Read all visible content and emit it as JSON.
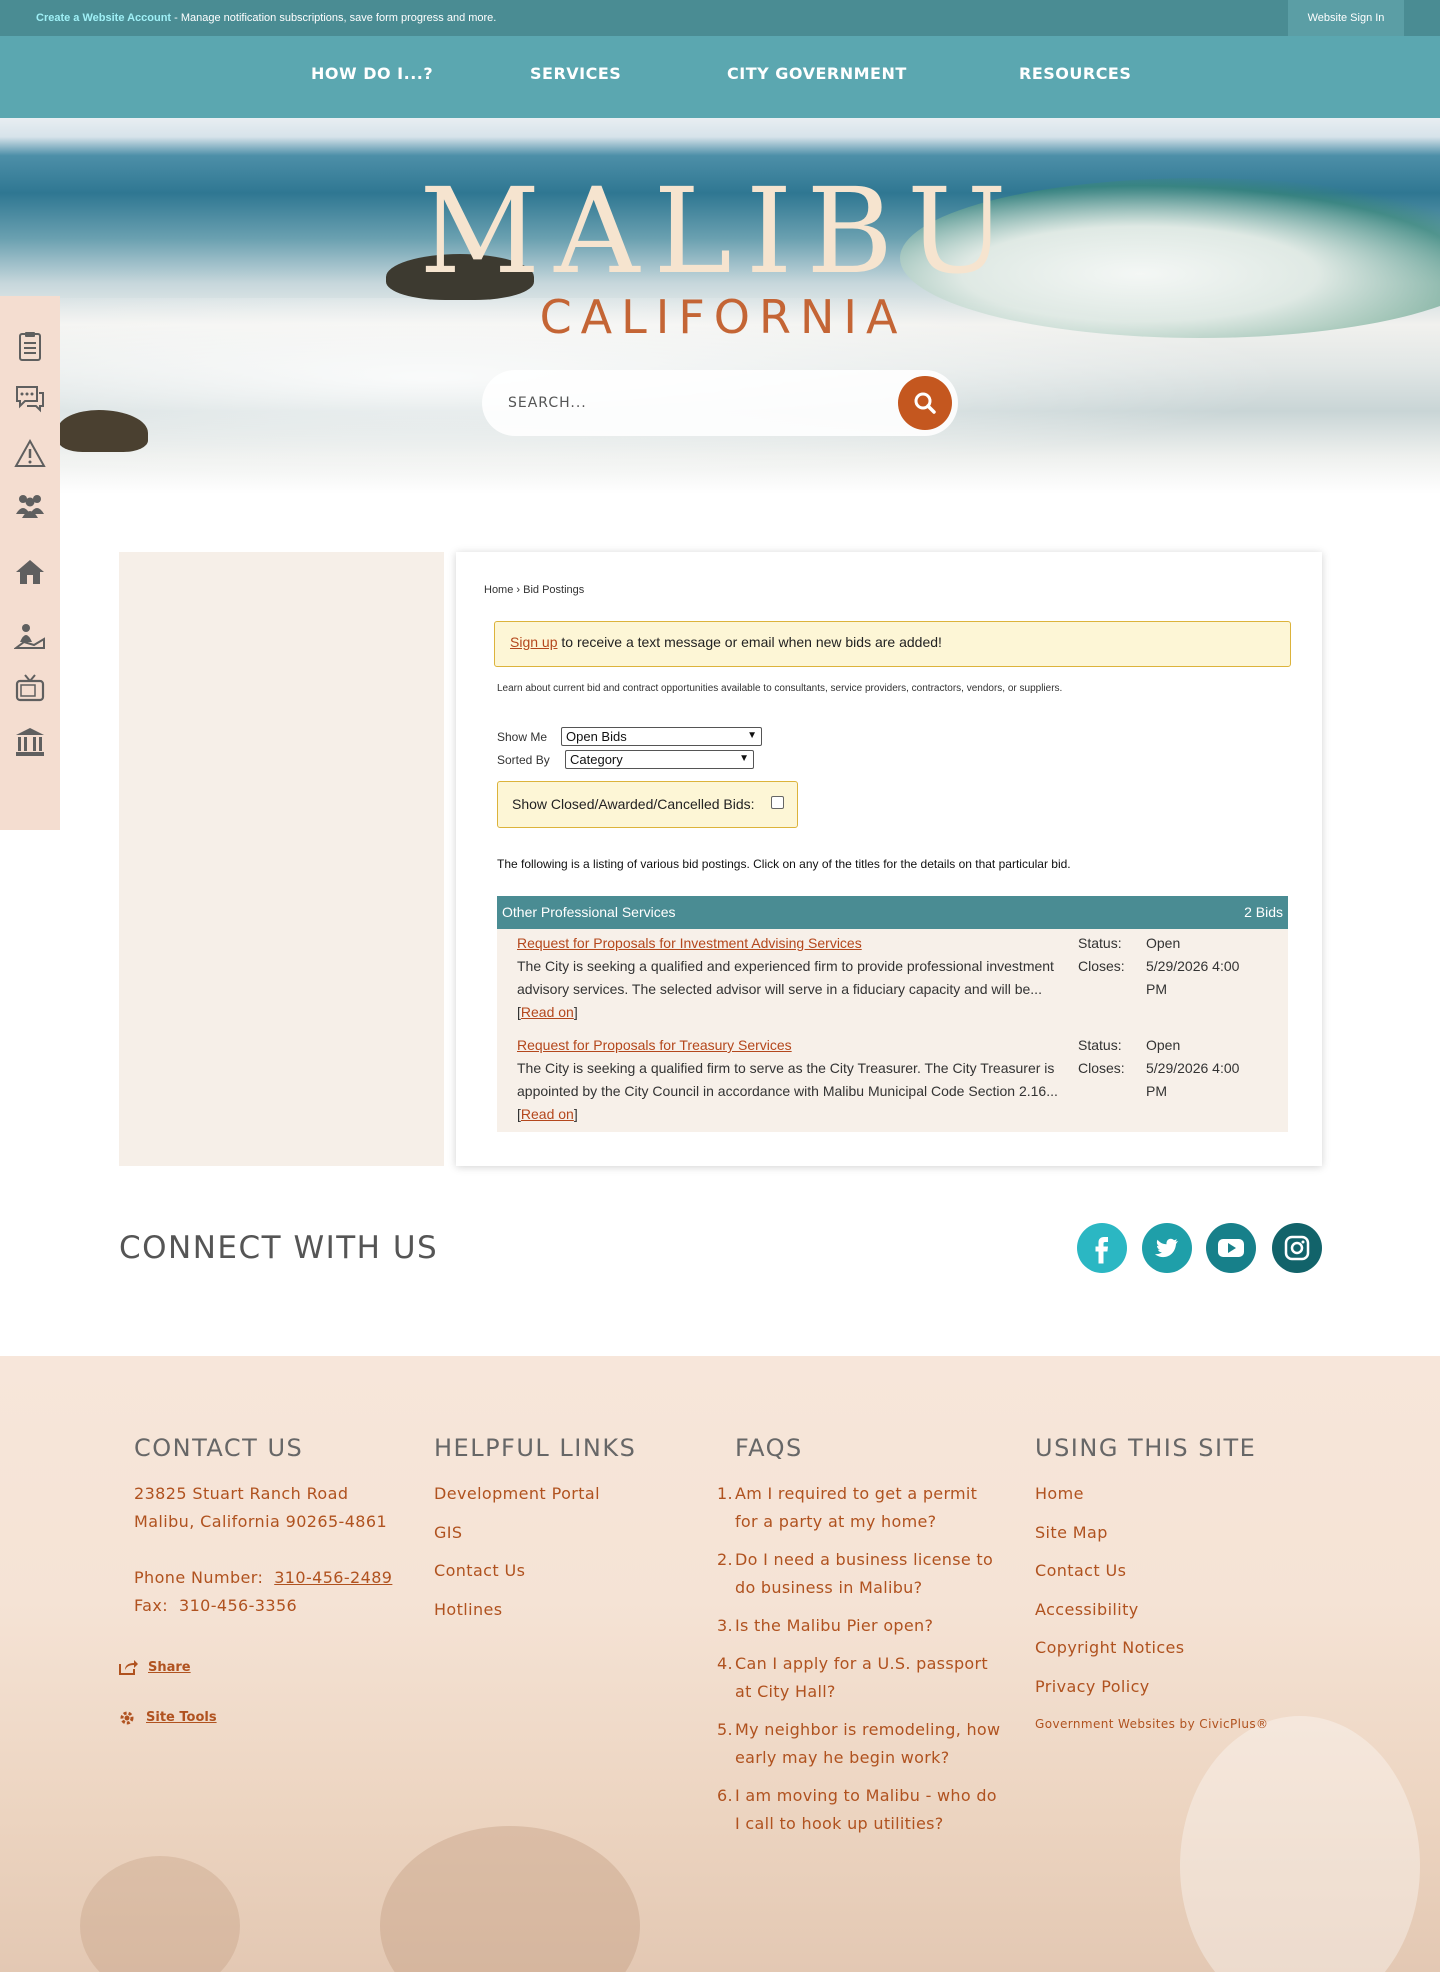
{
  "topbar": {
    "create_account": "Create a Website Account",
    "message": " - Manage notification subscriptions, save form progress and more.",
    "signin": "Website Sign In"
  },
  "nav": {
    "items": [
      {
        "label": "HOW DO I...?"
      },
      {
        "label": "SERVICES"
      },
      {
        "label": "CITY GOVERNMENT"
      },
      {
        "label": "RESOURCES"
      }
    ]
  },
  "hero": {
    "logo_main": "MALIBU",
    "logo_sub": "CALIFORNIA",
    "search_placeholder": "SEARCH..."
  },
  "sidebar": {
    "icons": [
      "clipboard-icon",
      "chat-icon",
      "alert-icon",
      "people-icon",
      "home-icon",
      "map-person-icon",
      "tv-icon",
      "government-building-icon"
    ]
  },
  "breadcrumb": {
    "home": "Home",
    "sep": "›",
    "current": "Bid Postings"
  },
  "notice": {
    "link": "Sign up",
    "text": " to receive a text message or email when new bids are added!"
  },
  "intro": "Learn about current bid and contract opportunities available to consultants, service providers, contractors, vendors, or suppliers.",
  "filters": {
    "show_me_label": "Show Me",
    "show_me_value": "Open Bids",
    "sorted_by_label": "Sorted By",
    "sorted_by_value": "Category",
    "closed_label": "Show Closed/Awarded/Cancelled Bids:",
    "closed_checked": false
  },
  "listing_text": "The following is a listing of various bid postings. Click on any of the titles for the details on that particular bid.",
  "category": {
    "name": "Other Professional Services",
    "count": "2 Bids"
  },
  "bids": [
    {
      "title": "Request for Proposals for Investment Advising Services",
      "description": "The City is seeking a qualified and experienced firm to provide professional investment advisory services. The selected advisor will serve in a fiduciary capacity and will be...",
      "read_on": "Read on",
      "status_label": "Status:",
      "status": "Open",
      "closes_label": "Closes:",
      "closes": "5/29/2026 4:00 PM"
    },
    {
      "title": "Request for Proposals for Treasury Services",
      "description": "The City is seeking a qualified firm to serve as the City Treasurer. The City Treasurer is appointed by the City Council in accordance with Malibu Municipal Code Section 2.16...",
      "read_on": "Read on",
      "status_label": "Status:",
      "status": "Open",
      "closes_label": "Closes:",
      "closes": "5/29/2026 4:00 PM"
    }
  ],
  "connect": {
    "heading": "CONNECT WITH US",
    "social": [
      {
        "name": "facebook-icon",
        "glyph": "f",
        "color": "#2bb7c3"
      },
      {
        "name": "twitter-icon",
        "glyph": "",
        "color": "#1f9fa9"
      },
      {
        "name": "youtube-icon",
        "glyph": "",
        "color": "#17808a"
      },
      {
        "name": "instagram-icon",
        "glyph": "",
        "color": "#12636a"
      }
    ]
  },
  "footer": {
    "contact": {
      "heading": "CONTACT US",
      "address1": "23825 Stuart Ranch Road",
      "address2": "Malibu, California 90265-4861",
      "phone_label": "Phone Number:",
      "phone": "310-456-2489",
      "fax_label": "Fax:",
      "fax": "310-456-3356"
    },
    "share": "Share",
    "site_tools": "Site Tools",
    "helpful": {
      "heading": "HELPFUL LINKS",
      "links": [
        "Development Portal",
        "GIS",
        "Contact Us",
        "Hotlines"
      ]
    },
    "faqs": {
      "heading": "FAQS",
      "items": [
        "Am I required to get a permit for a party at my home?",
        "Do I need a business license to do business in Malibu?",
        "Is the Malibu Pier open?",
        "Can I apply for a U.S. passport at City Hall?",
        "My neighbor is remodeling, how early may he begin work?",
        "I am moving to Malibu - who do I call to hook up utilities?"
      ]
    },
    "using": {
      "heading": "USING THIS SITE",
      "links": [
        "Home",
        "Site Map",
        "Contact Us",
        "Accessibility",
        "Copyright Notices",
        "Privacy Policy"
      ]
    },
    "civicplus": "Government Websites by CivicPlus®"
  }
}
